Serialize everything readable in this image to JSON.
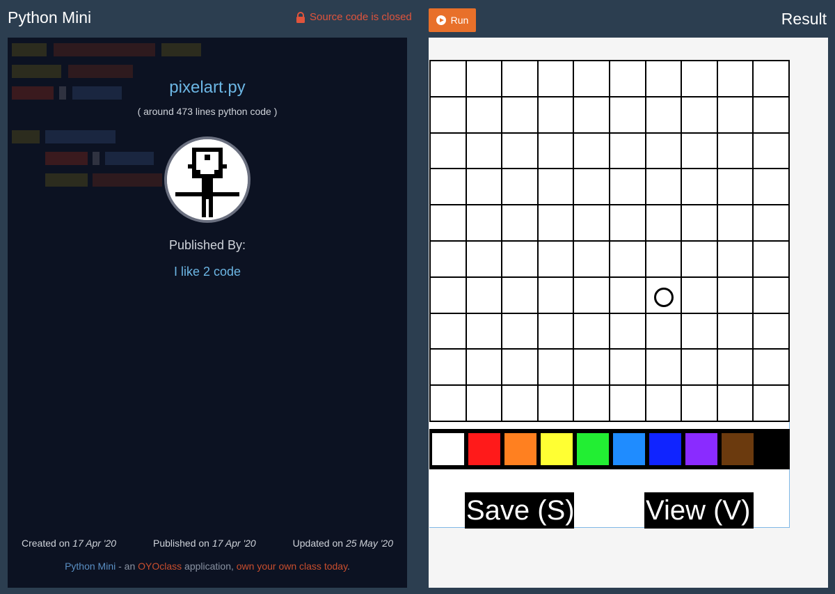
{
  "header": {
    "app_title": "Python Mini",
    "source_status": "Source code is closed",
    "run_label": "Run",
    "result_title": "Result"
  },
  "project": {
    "file_name": "pixelart.py",
    "line_count_text": "( around 473 lines python code )",
    "published_by_label": "Published By:",
    "author": "I like 2 code"
  },
  "dates": {
    "created_label": "Created on",
    "created_value": "17 Apr '20",
    "published_label": "Published on",
    "published_value": "17 Apr '20",
    "updated_label": "Updated on",
    "updated_value": "25 May '20"
  },
  "footer": {
    "app_link": "Python Mini",
    "middle_text": " - an ",
    "brand_link": "OYOclass",
    "after_brand": " application, ",
    "cta_link": "own your own class today",
    "end": "."
  },
  "result": {
    "grid_rows": 10,
    "grid_cols": 10,
    "palette": [
      "#ffffff",
      "#ff1a1a",
      "#ff8020",
      "#ffff33",
      "#22ee33",
      "#1f8cff",
      "#1024ff",
      "#8a2bff",
      "#6b3a0e",
      "#000000"
    ],
    "save_label": "Save (S)",
    "view_label": "View (V)"
  },
  "colors": {
    "background": "#2c3e50",
    "code_panel": "#0c1222",
    "accent_orange": "#e8702a",
    "link_blue": "#6cb6e4",
    "closed_red": "#e0543c"
  }
}
